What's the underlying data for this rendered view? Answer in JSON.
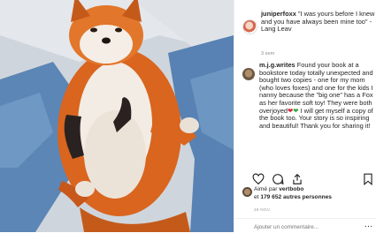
{
  "post": {
    "author": "juniperfoxx",
    "caption": "\"I was yours before I knew and you have always been mine too\" -Lang Leav",
    "time": "3 sem"
  },
  "comment": {
    "author": "m.j.g.writes",
    "text_part1": "Found your book at a bookstore today totally unexpected and bought two copies - one for my mom (who loves foxes) and one for the kids I nanny because the \"big one\" has a Fox as her favorite soft toy! They were both overjoyed",
    "emoji": "❤",
    "text_part2": "I will get myself a copy of the book too. Your story is so inspiring and beautiful! Thank you for sharing it!"
  },
  "likes": {
    "line1_prefix": "Aimé par",
    "liker": "vertbobo",
    "line2_connector": "et",
    "count": "179 652 autres personnes"
  },
  "post_date": "29 NOV.",
  "comment_placeholder": "Ajouter un commentaire...",
  "icons": [
    "heart-icon",
    "comment-icon",
    "share-icon",
    "bookmark-icon",
    "more-options-icon"
  ]
}
